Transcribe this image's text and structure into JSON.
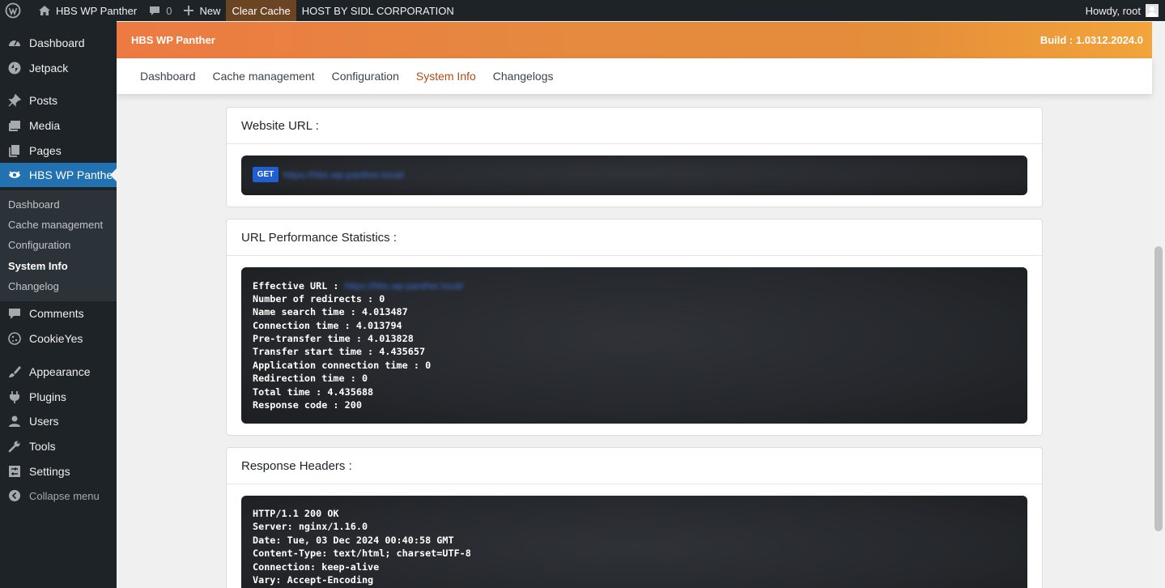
{
  "admin_bar": {
    "site_name": "HBS WP Panther",
    "comments_count": "0",
    "new_label": "New",
    "clear_cache_label": "Clear Cache",
    "host_label": "HOST BY SIDL CORPORATION",
    "howdy": "Howdy, root"
  },
  "sidebar": {
    "items": [
      {
        "label": "Dashboard",
        "icon": "dashboard-icon"
      },
      {
        "label": "Jetpack",
        "icon": "jetpack-icon"
      },
      {
        "label": "Posts",
        "icon": "pin-icon"
      },
      {
        "label": "Media",
        "icon": "media-icon"
      },
      {
        "label": "Pages",
        "icon": "pages-icon"
      },
      {
        "label": "HBS WP Panther",
        "icon": "panther-icon"
      },
      {
        "label": "Comments",
        "icon": "comment-icon"
      },
      {
        "label": "CookieYes",
        "icon": "cookie-icon"
      },
      {
        "label": "Appearance",
        "icon": "brush-icon"
      },
      {
        "label": "Plugins",
        "icon": "plugin-icon"
      },
      {
        "label": "Users",
        "icon": "user-icon"
      },
      {
        "label": "Tools",
        "icon": "wrench-icon"
      },
      {
        "label": "Settings",
        "icon": "settings-icon"
      }
    ],
    "submenu": [
      "Dashboard",
      "Cache management",
      "Configuration",
      "System Info",
      "Changelog"
    ],
    "collapse_label": "Collapse menu",
    "accent_color": "#2271b1"
  },
  "plugin": {
    "title": "HBS WP Panther",
    "build": "Build : 1.0312.2024.0",
    "tabs": [
      "Dashboard",
      "Cache management",
      "Configuration",
      "System Info",
      "Changelogs"
    ]
  },
  "website_url": {
    "heading": "Website URL :",
    "method": "GET",
    "url": "https://hbs.wp-panther.local/"
  },
  "performance": {
    "heading": "URL Performance Statistics :",
    "effective_label": "Effective URL : ",
    "effective_url": "https://hbs.wp-panther.local/",
    "lines": [
      "Number of redirects : 0",
      "Name search time : 4.013487",
      "Connection time : 4.013794",
      "Pre-transfer time : 4.013828",
      "Transfer start time : 4.435657",
      "Application connection time : 0",
      "Redirection time : 0",
      "Total time : 4.435688",
      "Response code : 200"
    ]
  },
  "headers": {
    "heading": "Response Headers :",
    "lines": [
      "HTTP/1.1 200 OK",
      "Server: nginx/1.16.0",
      "Date: Tue, 03 Dec 2024 00:40:58 GMT",
      "Content-Type: text/html; charset=UTF-8",
      "Connection: keep-alive",
      "Vary: Accept-Encoding"
    ]
  }
}
